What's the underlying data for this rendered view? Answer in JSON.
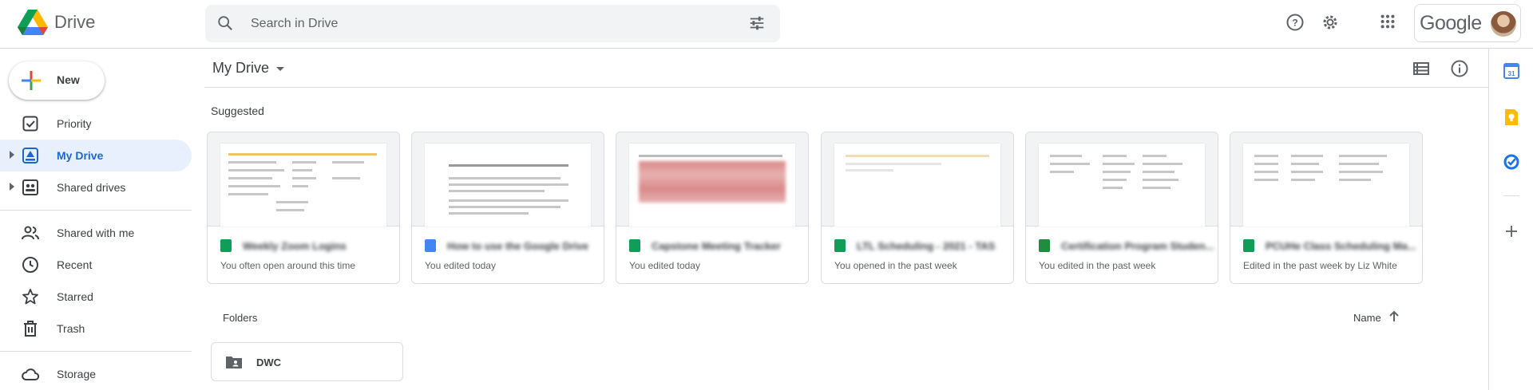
{
  "app": {
    "name": "Drive"
  },
  "search": {
    "placeholder": "Search in Drive"
  },
  "account": {
    "brand": "Google"
  },
  "new_button": {
    "label": "New"
  },
  "sidebar": {
    "items": [
      {
        "label": "Priority"
      },
      {
        "label": "My Drive"
      },
      {
        "label": "Shared drives"
      },
      {
        "label": "Shared with me"
      },
      {
        "label": "Recent"
      },
      {
        "label": "Starred"
      },
      {
        "label": "Trash"
      },
      {
        "label": "Storage"
      }
    ]
  },
  "main": {
    "title": "My Drive",
    "suggested_label": "Suggested",
    "folders_label": "Folders",
    "sort_label": "Name",
    "files": [
      {
        "name": "Weekly Zoom Logins",
        "sub": "You often open around this time",
        "type": "sheets",
        "color": "#0f9d58"
      },
      {
        "name": "How to use the Google Drive",
        "sub": "You edited today",
        "type": "docs",
        "color": "#4285f4"
      },
      {
        "name": "Capstone Meeting Tracker",
        "sub": "You edited today",
        "type": "sheets",
        "color": "#0f9d58"
      },
      {
        "name": "LTL Scheduling - 2021 - TAS",
        "sub": "You opened in the past week",
        "type": "sheets",
        "color": "#0f9d58"
      },
      {
        "name": "Certification Program Studen...",
        "sub": "You edited in the past week",
        "type": "excel",
        "color": "#1e8e3e"
      },
      {
        "name": "PCUHe Class Scheduling Ma...",
        "sub": "Edited in the past week by Liz White",
        "type": "sheets",
        "color": "#0f9d58"
      }
    ],
    "folders": [
      {
        "name": "DWC"
      }
    ]
  },
  "colors": {
    "accent": "#1967d2",
    "active_bg": "#e8f0fe",
    "border": "#dadce0"
  }
}
